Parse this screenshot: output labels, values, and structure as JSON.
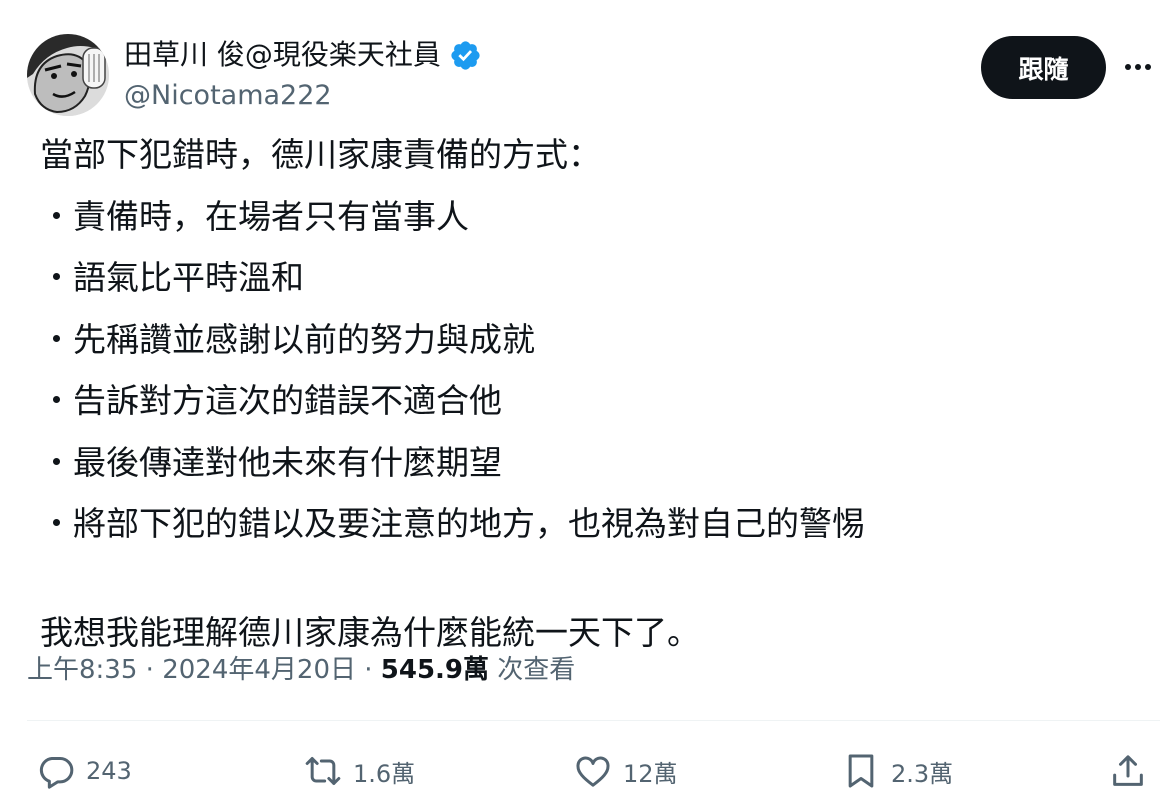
{
  "author": {
    "display_name": "田草川 俊@現役楽天社員",
    "handle": "@Nicotama222",
    "verified_icon": "verified-badge-icon",
    "avatar": "manga-character-avatar"
  },
  "header": {
    "follow_label": "跟隨",
    "more_icon": "more-icon"
  },
  "tweet": {
    "lines": [
      "當部下犯錯時，德川家康責備的方式：",
      "・責備時，在場者只有當事人",
      "・語氣比平時溫和",
      "・先稱讚並感謝以前的努力與成就",
      "・告訴對方這次的錯誤不適合他",
      "・最後傳達對他未來有什麼期望",
      "・將部下犯的錯以及要注意的地方，也視為對自己的警惕"
    ],
    "closing": "我想我能理解德川家康為什麼能統一天下了。"
  },
  "meta": {
    "time": "上午8:35",
    "separator": " · ",
    "date": "2024年4月20日",
    "views_count": "545.9萬",
    "views_label": "次查看"
  },
  "actions": {
    "reply_count": "243",
    "retweet_count": "1.6萬",
    "like_count": "12萬",
    "bookmark_count": "2.3萬"
  },
  "colors": {
    "text": "#0f1419",
    "secondary": "#536471",
    "verified": "#1d9bf0",
    "button_bg": "#0f1419"
  }
}
